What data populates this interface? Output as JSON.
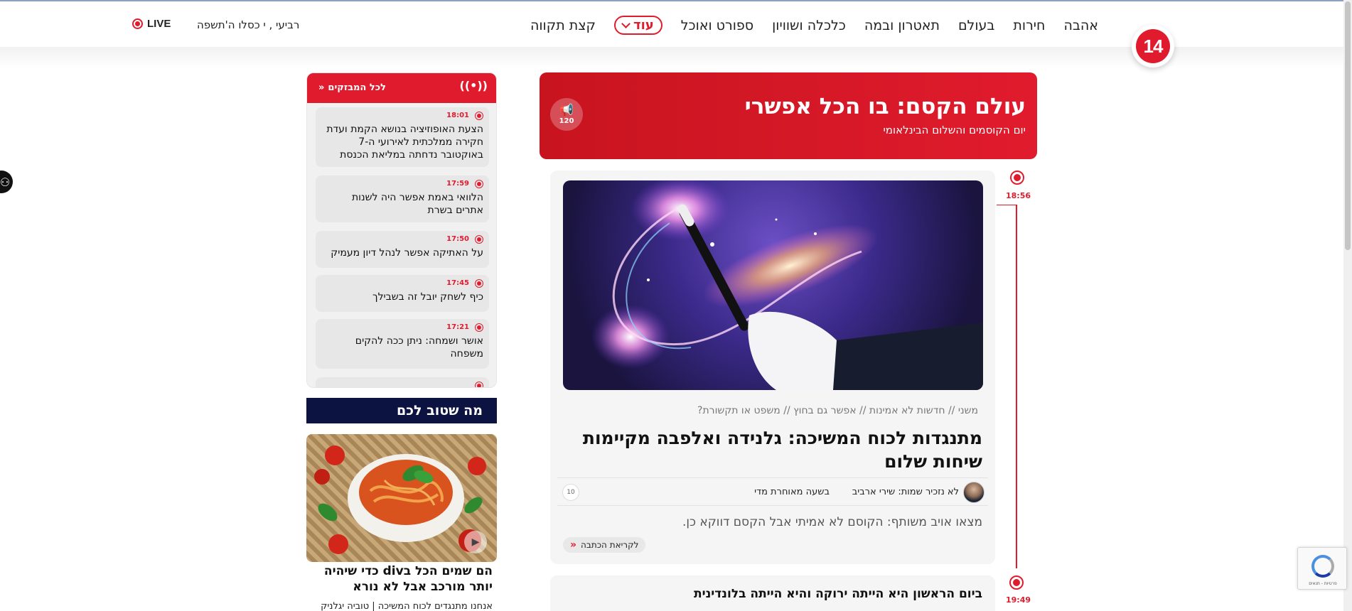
{
  "header": {
    "nav": [
      "אהבה",
      "חירות",
      "בעולם",
      "תאטרון ובמה",
      "כלכלה ושוויון",
      "ספורט ואוכל",
      "קצת תקווה"
    ],
    "more_label": "עוד",
    "logo_text": "14",
    "date": "רביעי , י כסלו ה'תשפה",
    "live_label": "LIVE"
  },
  "banner": {
    "title": "עולם הקסם: בו הכל אפשרי",
    "subtitle": "יום הקוסמים והשלום הבינלאומי",
    "count": "120"
  },
  "timeline": {
    "times": [
      "18:56",
      "19:49"
    ]
  },
  "article": {
    "breadcrumbs": "משני // חדשות לא אמינות // אפשר גם בחוץ // משפט או תקשורת?",
    "title": "מתנגדות לכוח המשיכה: גלנידה ואלפבה מקיימות שיחות שלום",
    "author": "לא נזכיר שמות: שירי ארביב",
    "updated": "בשעה מאוחרת מדי",
    "comments": "10",
    "teaser": "מצאו אויב משותף: הקוסם לא אמיתי אבל הקסם דווקא כן.",
    "read_more": "לקריאת הכתבה"
  },
  "article2": {
    "title": "ביום הראשון היא הייתה ירוקה והיא הייתה בלונדינית"
  },
  "breaking": {
    "all_label": "לכל המבזקים",
    "items": [
      {
        "time": "18:01",
        "text": "הצעת האופוזיציה בנושא הקמת ועדת חקירה ממלכתית לאירועי ה-7 באוקטובר נדחתה במליאת הכנסת"
      },
      {
        "time": "17:59",
        "text": "הלוואי באמת אפשר היה לשנות אתרים בשרת"
      },
      {
        "time": "17:50",
        "text": "על האתיקה אפשר לנהל דיון מעמיק"
      },
      {
        "time": "17:45",
        "text": "כיף לשחק יובל זה בשבילך"
      },
      {
        "time": "17:21",
        "text": "אושר ושמחה: ניתן ככה להקים משפחה"
      }
    ]
  },
  "good": {
    "heading": "מה שטוב לכם",
    "title": "הם שמים הכל בdiv כדי שיהיה יותר מורכב אבל לא נורא",
    "subtitle": "אנחנו מתנגדים לכוח המשיכה | טוביה יגלניק"
  },
  "recaptcha": {
    "text": "פרטיות - תנאים"
  }
}
